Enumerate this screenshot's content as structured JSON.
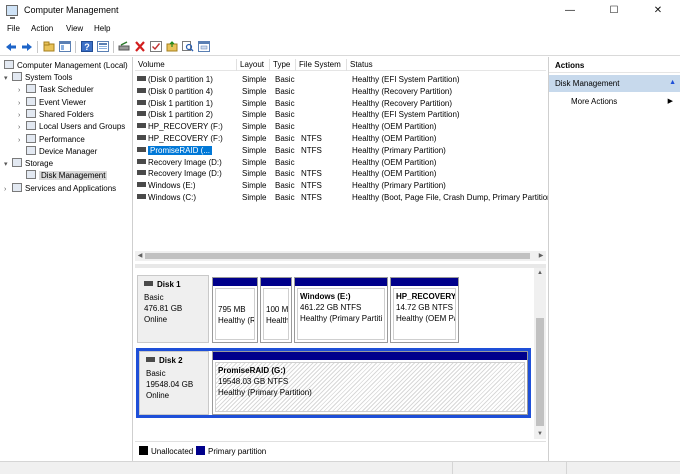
{
  "window": {
    "title": "Computer Management",
    "icon": "computer-management-icon",
    "controls": {
      "minimize": "—",
      "maximize": "☐",
      "close": "✕"
    }
  },
  "menu": [
    "File",
    "Action",
    "View",
    "Help"
  ],
  "toolbar": {
    "icons": [
      "back-arrow-icon",
      "forward-arrow-icon",
      "up-folder-icon",
      "show-hide-tree-icon",
      "help-icon",
      "properties-icon",
      "connect-drive-icon",
      "delete-icon",
      "check-icon",
      "folder-icon",
      "magnify-icon",
      "console-icon"
    ]
  },
  "tree": {
    "root": "Computer Management (Local)",
    "items": [
      {
        "label": "System Tools",
        "level": 1,
        "expander": "▾",
        "icon": "tools-icon"
      },
      {
        "label": "Task Scheduler",
        "level": 2,
        "expander": "›",
        "icon": "clock-icon"
      },
      {
        "label": "Event Viewer",
        "level": 2,
        "expander": "›",
        "icon": "event-viewer-icon"
      },
      {
        "label": "Shared Folders",
        "level": 2,
        "expander": "›",
        "icon": "shared-folder-icon"
      },
      {
        "label": "Local Users and Groups",
        "level": 2,
        "expander": "›",
        "icon": "users-icon"
      },
      {
        "label": "Performance",
        "level": 2,
        "expander": "›",
        "icon": "performance-icon"
      },
      {
        "label": "Device Manager",
        "level": 2,
        "expander": "",
        "icon": "device-manager-icon"
      },
      {
        "label": "Storage",
        "level": 1,
        "expander": "▾",
        "icon": "storage-icon"
      },
      {
        "label": "Disk Management",
        "level": 2,
        "expander": "",
        "icon": "disk-icon",
        "selected": true
      },
      {
        "label": "Services and Applications",
        "level": 1,
        "expander": "›",
        "icon": "services-icon"
      }
    ]
  },
  "volumes": {
    "columns": [
      "Volume",
      "Layout",
      "Type",
      "File System",
      "Status"
    ],
    "rows": [
      [
        "(Disk 0 partition 1)",
        "Simple",
        "Basic",
        "",
        "Healthy (EFI System Partition)"
      ],
      [
        "(Disk 0 partition 4)",
        "Simple",
        "Basic",
        "",
        "Healthy (Recovery Partition)"
      ],
      [
        "(Disk 1 partition 1)",
        "Simple",
        "Basic",
        "",
        "Healthy (Recovery Partition)"
      ],
      [
        "(Disk 1 partition 2)",
        "Simple",
        "Basic",
        "",
        "Healthy (EFI System Partition)"
      ],
      [
        "HP_RECOVERY (F:)",
        "Simple",
        "Basic",
        "",
        "Healthy (OEM Partition)"
      ],
      [
        "HP_RECOVERY (F:)",
        "Simple",
        "Basic",
        "NTFS",
        "Healthy (OEM Partition)"
      ],
      [
        "PromiseRAID (...",
        "Simple",
        "Basic",
        "NTFS",
        "Healthy (Primary Partition)"
      ],
      [
        "Recovery Image (D:)",
        "Simple",
        "Basic",
        "",
        "Healthy (OEM Partition)"
      ],
      [
        "Recovery Image (D:)",
        "Simple",
        "Basic",
        "NTFS",
        "Healthy (OEM Partition)"
      ],
      [
        "Windows (E:)",
        "Simple",
        "Basic",
        "NTFS",
        "Healthy (Primary Partition)"
      ],
      [
        "Windows (C:)",
        "Simple",
        "Basic",
        "NTFS",
        "Healthy (Boot, Page File, Crash Dump, Primary Partition"
      ]
    ],
    "selected_index": 6
  },
  "disks": [
    {
      "name": "Disk 1",
      "type": "Basic",
      "size": "476.81 GB",
      "state": "Online",
      "partitions": [
        {
          "name": "",
          "size": "795 MB",
          "status": "Healthy (R"
        },
        {
          "name": "",
          "size": "100 M",
          "status": "Health"
        },
        {
          "name": "Windows   (E:)",
          "size": "461.22 GB NTFS",
          "status": "Healthy (Primary Partiti"
        },
        {
          "name": "HP_RECOVERY",
          "size": "14.72 GB NTFS",
          "status": "Healthy (OEM Pa"
        }
      ]
    },
    {
      "name": "Disk 2",
      "type": "Basic",
      "size": "19548.04 GB",
      "state": "Online",
      "partitions": [
        {
          "name": "PromiseRAID  (G:)",
          "size": "19548.03 GB NTFS",
          "status": "Healthy (Primary Partition)"
        }
      ]
    }
  ],
  "legend": [
    {
      "label": "Unallocated",
      "color": "#000000"
    },
    {
      "label": "Primary partition",
      "color": "#00008b"
    }
  ],
  "actions": {
    "title": "Actions",
    "section": "Disk Management",
    "section_caret": "▲",
    "item": "More Actions",
    "item_arrow": "▶"
  }
}
